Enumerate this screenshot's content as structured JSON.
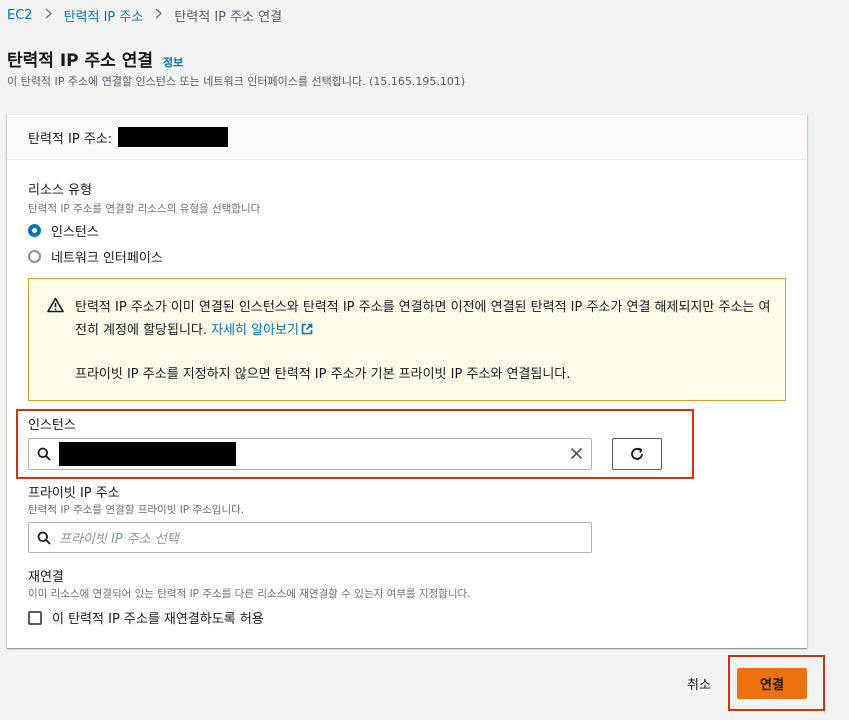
{
  "breadcrumb": {
    "items": [
      "EC2",
      "탄력적 IP 주소",
      "탄력적 IP 주소 연결"
    ]
  },
  "page": {
    "title": "탄력적 IP 주소 연결",
    "info_link": "정보",
    "description": "이 탄력적 IP 주소에 연결할 인스턴스 또는 네트워크 인터페이스를 선택합니다. (15.165.195.101)"
  },
  "panel": {
    "header_label": "탄력적 IP 주소:",
    "resource_type": {
      "label": "리소스 유형",
      "description": "탄력적 IP 주소를 연결할 리소스의 유형을 선택합니다",
      "options": [
        {
          "label": "인스턴스",
          "selected": true
        },
        {
          "label": "네트워크 인터페이스",
          "selected": false
        }
      ]
    },
    "alert": {
      "text": "탄력적 IP 주소가 이미 연결된 인스턴스와 탄력적 IP 주소를 연결하면 이전에 연결된 탄력적 IP 주소가 연결 해제되지만 주소는 여전히 계정에 할당됩니다.",
      "link": "자세히 알아보기",
      "text2": "프라이빗 IP 주소를 지정하지 않으면 탄력적 IP 주소가 기본 프라이빗 IP 주소와 연결됩니다."
    },
    "instance": {
      "label": "인스턴스"
    },
    "private_ip": {
      "label": "프라이빗 IP 주소",
      "description": "탄력적 IP 주소를 연결할 프라이빗 IP 주소입니다.",
      "placeholder": "프라이빗 IP 주소 선택"
    },
    "reassociate": {
      "label": "재연결",
      "description": "이미 리소스에 연결되어 있는 탄력적 IP 주소를 다른 리소스에 재연결할 수 있는지 여부를 지정합니다.",
      "checkbox_label": "이 탄력적 IP 주소를 재연결하도록 허용"
    }
  },
  "footer": {
    "cancel_label": "취소",
    "connect_label": "연결"
  },
  "colors": {
    "accent": "#0073bb",
    "primary_button": "#ec7211",
    "highlight_box": "#d13212",
    "warning_border": "#d4a22b"
  }
}
